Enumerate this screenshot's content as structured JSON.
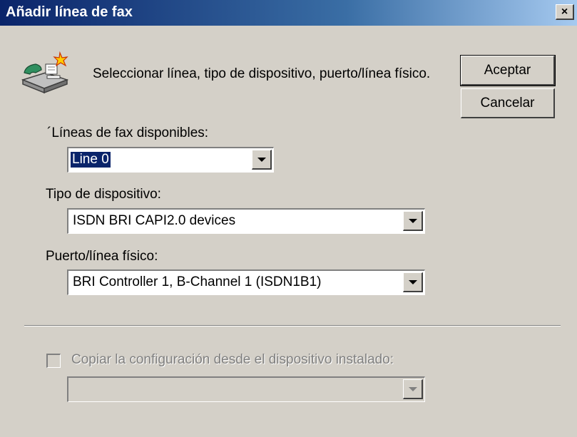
{
  "window": {
    "title": "Añadir línea de fax",
    "close_label": "×"
  },
  "description": "Seleccionar línea, tipo de dispositivo, puerto/línea físico.",
  "buttons": {
    "ok": "Aceptar",
    "cancel": "Cancelar"
  },
  "lines": {
    "label": "´Líneas de fax disponibles:",
    "value": "Line 0"
  },
  "device_type": {
    "label": "Tipo de dispositivo:",
    "value": "ISDN BRI CAPI2.0 devices"
  },
  "port": {
    "label": "Puerto/línea físico:",
    "value": "BRI Controller 1, B-Channel 1 (ISDN1B1)"
  },
  "copy_settings": {
    "label": "Copiar la configuración desde el dispositivo instalado:",
    "checked": false,
    "value": ""
  },
  "icons": {
    "fax": "fax-machine-icon",
    "close": "close-icon",
    "dropdown": "chevron-down-icon"
  }
}
